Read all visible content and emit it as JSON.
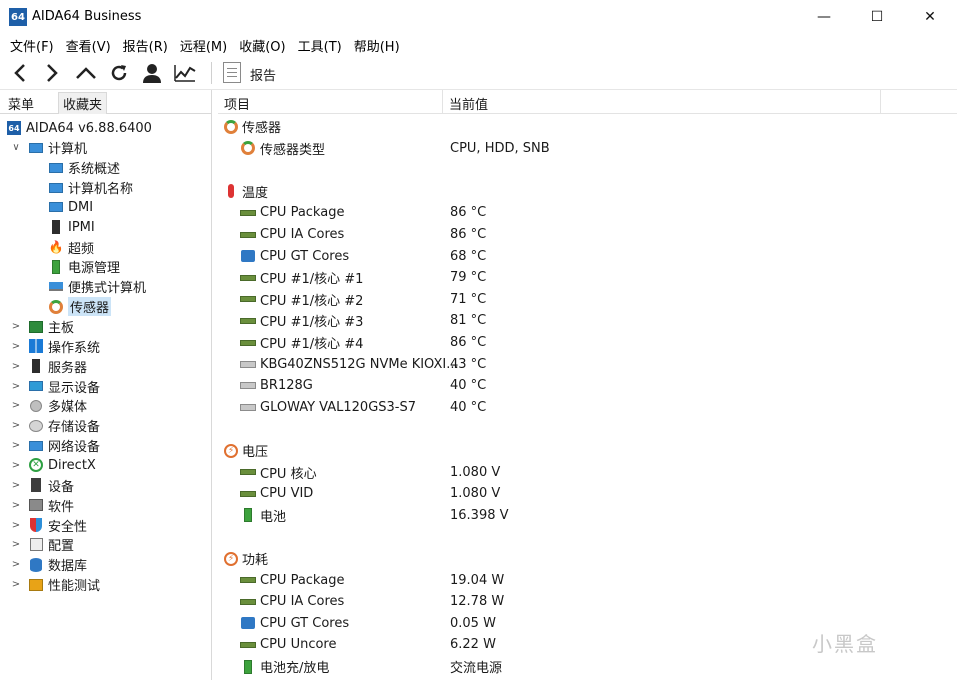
{
  "window": {
    "icon_text": "64",
    "title": "AIDA64 Business",
    "min_glyph": "—",
    "max_glyph": "☐",
    "close_glyph": "✕"
  },
  "menu": [
    "文件(F)",
    "查看(V)",
    "报告(R)",
    "远程(M)",
    "收藏(O)",
    "工具(T)",
    "帮助(H)"
  ],
  "toolbar": {
    "buttons": [
      "back-icon",
      "forward-icon",
      "up-icon",
      "refresh-icon",
      "user-icon",
      "chart-icon"
    ],
    "report_label": "报告"
  },
  "left_tabs": {
    "menu": "菜单",
    "favorites": "收藏夹"
  },
  "tree": [
    {
      "label": "AIDA64 v6.88.6400",
      "icon": "aida64-icon",
      "level": 0,
      "chev": ""
    },
    {
      "label": "计算机",
      "icon": "computer-icon",
      "level": 1,
      "chev": "∨"
    },
    {
      "label": "系统概述",
      "icon": "computer-icon",
      "level": 2,
      "chev": ""
    },
    {
      "label": "计算机名称",
      "icon": "computer-icon",
      "level": 2,
      "chev": ""
    },
    {
      "label": "DMI",
      "icon": "computer-icon",
      "level": 2,
      "chev": ""
    },
    {
      "label": "IPMI",
      "icon": "server-icon",
      "level": 2,
      "chev": ""
    },
    {
      "label": "超频",
      "icon": "fire-icon",
      "level": 2,
      "chev": ""
    },
    {
      "label": "电源管理",
      "icon": "battery-icon",
      "level": 2,
      "chev": ""
    },
    {
      "label": "便携式计算机",
      "icon": "laptop-icon",
      "level": 2,
      "chev": ""
    },
    {
      "label": "传感器",
      "icon": "gauge-icon",
      "level": 2,
      "chev": "",
      "selected": true
    },
    {
      "label": "主板",
      "icon": "motherboard-icon",
      "level": 1,
      "chev": ">"
    },
    {
      "label": "操作系统",
      "icon": "windows-icon",
      "level": 1,
      "chev": ">"
    },
    {
      "label": "服务器",
      "icon": "server-icon",
      "level": 1,
      "chev": ">"
    },
    {
      "label": "显示设备",
      "icon": "monitor-icon",
      "level": 1,
      "chev": ">"
    },
    {
      "label": "多媒体",
      "icon": "speaker-icon",
      "level": 1,
      "chev": ">"
    },
    {
      "label": "存储设备",
      "icon": "storage-icon",
      "level": 1,
      "chev": ">"
    },
    {
      "label": "网络设备",
      "icon": "network-icon",
      "level": 1,
      "chev": ">"
    },
    {
      "label": "DirectX",
      "icon": "xbox-icon",
      "level": 1,
      "chev": ">"
    },
    {
      "label": "设备",
      "icon": "device-icon",
      "level": 1,
      "chev": ">"
    },
    {
      "label": "软件",
      "icon": "software-icon",
      "level": 1,
      "chev": ">"
    },
    {
      "label": "安全性",
      "icon": "shield-icon",
      "level": 1,
      "chev": ">"
    },
    {
      "label": "配置",
      "icon": "config-icon",
      "level": 1,
      "chev": ">"
    },
    {
      "label": "数据库",
      "icon": "database-icon",
      "level": 1,
      "chev": ">"
    },
    {
      "label": "性能测试",
      "icon": "benchmark-icon",
      "level": 1,
      "chev": ">"
    }
  ],
  "columns": {
    "item": "项目",
    "value": "当前值"
  },
  "rows": [
    {
      "type": "group",
      "name": "传感器",
      "icon": "gauge-icon",
      "value": ""
    },
    {
      "type": "item",
      "name": "传感器类型",
      "icon": "gauge-icon",
      "value": "CPU, HDD, SNB"
    },
    {
      "type": "spacer"
    },
    {
      "type": "group",
      "name": "温度",
      "icon": "thermometer-icon",
      "value": ""
    },
    {
      "type": "item",
      "name": "CPU Package",
      "icon": "chip-icon",
      "value": "86 °C"
    },
    {
      "type": "item",
      "name": "CPU IA Cores",
      "icon": "chip-icon",
      "value": "86 °C"
    },
    {
      "type": "item",
      "name": "CPU GT Cores",
      "icon": "gpu-icon",
      "value": "68 °C"
    },
    {
      "type": "item",
      "name": "CPU #1/核心 #1",
      "icon": "chip-icon",
      "value": "79 °C"
    },
    {
      "type": "item",
      "name": "CPU #1/核心 #2",
      "icon": "chip-icon",
      "value": "71 °C"
    },
    {
      "type": "item",
      "name": "CPU #1/核心 #3",
      "icon": "chip-icon",
      "value": "81 °C"
    },
    {
      "type": "item",
      "name": "CPU #1/核心 #4",
      "icon": "chip-icon",
      "value": "86 °C"
    },
    {
      "type": "item",
      "name": "KBG40ZNS512G NVMe KIOXI...",
      "icon": "disk-icon",
      "value": "43 °C"
    },
    {
      "type": "item",
      "name": "BR128G",
      "icon": "disk-icon",
      "value": "40 °C"
    },
    {
      "type": "item",
      "name": "GLOWAY VAL120GS3-S7",
      "icon": "disk-icon",
      "value": "40 °C"
    },
    {
      "type": "spacer"
    },
    {
      "type": "group",
      "name": "电压",
      "icon": "voltage-icon",
      "value": ""
    },
    {
      "type": "item",
      "name": "CPU 核心",
      "icon": "chip-icon",
      "value": "1.080 V"
    },
    {
      "type": "item",
      "name": "CPU VID",
      "icon": "chip-icon",
      "value": "1.080 V"
    },
    {
      "type": "item",
      "name": "电池",
      "icon": "battery-icon",
      "value": "16.398 V"
    },
    {
      "type": "spacer"
    },
    {
      "type": "group",
      "name": "功耗",
      "icon": "voltage-icon",
      "value": ""
    },
    {
      "type": "item",
      "name": "CPU Package",
      "icon": "chip-icon",
      "value": "19.04 W"
    },
    {
      "type": "item",
      "name": "CPU IA Cores",
      "icon": "chip-icon",
      "value": "12.78 W"
    },
    {
      "type": "item",
      "name": "CPU GT Cores",
      "icon": "gpu-icon",
      "value": "0.05 W"
    },
    {
      "type": "item",
      "name": "CPU Uncore",
      "icon": "chip-icon",
      "value": "6.22 W"
    },
    {
      "type": "item",
      "name": "电池充/放电",
      "icon": "battery-icon",
      "value": "交流电源"
    }
  ],
  "watermark": "小黑盒"
}
